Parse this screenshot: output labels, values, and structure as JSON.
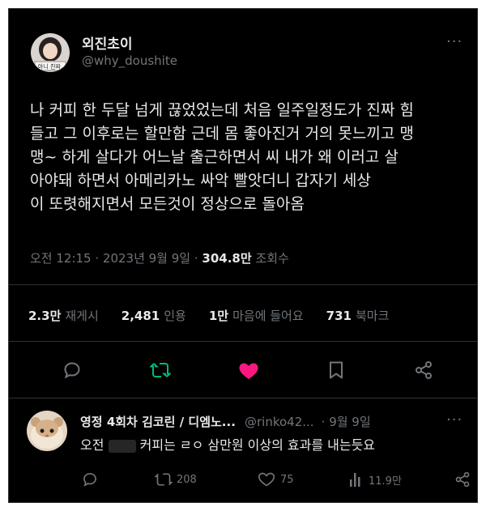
{
  "tweet": {
    "author_name": "외진초이",
    "author_handle": "@why_doushite",
    "avatar_caption": "아니 진짜.",
    "more_label": "···",
    "text": "나 커피 한 두달 넘게 끊었었는데 처음 일주일정도가 진짜 힘\n들고 그 이후로는 할만함 근데 몸 좋아진거 거의 못느끼고 맹\n맹~ 하게 살다가 어느날 출근하면서 씨     내가 왜 이러고 살\n아야돼           하면서 아메리카노 싸악 빨앗더니 갑자기 세상\n이 또렷해지면서 모든것이 정상으로 돌아옴",
    "time": "오전 12:15 · 2023년 9월 9일 · ",
    "views": "304.8만",
    "views_label": "조회수"
  },
  "stats": [
    {
      "value": "2.3만",
      "label": "재게시"
    },
    {
      "value": "2,481",
      "label": "인용"
    },
    {
      "value": "1만",
      "label": "마음에 들어요"
    },
    {
      "value": "731",
      "label": "북마크"
    }
  ],
  "reply": {
    "name": "영정 4회차 김코린 / 디엠노...",
    "handle": "@rinko42...",
    "date": "· 9월 9일",
    "text_start": "오전",
    "text_end": "커피는 ㄹㅇ 삼만원 이상의 효과를 내는듯요",
    "retweets": "208",
    "likes": "75",
    "views": "11.9만"
  },
  "colors": {
    "background": "#000000",
    "like": "#f91880",
    "retweet": "#00ba7c",
    "muted": "#71767b"
  }
}
